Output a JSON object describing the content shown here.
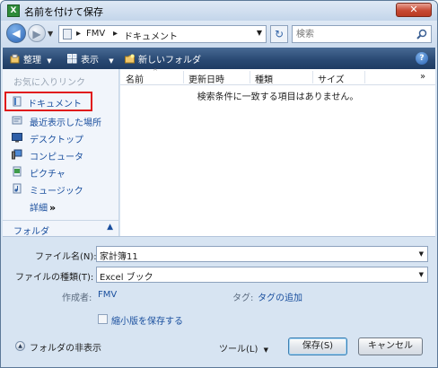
{
  "window": {
    "title": "名前を付けて保存",
    "app_icon_text": "X"
  },
  "nav": {
    "breadcrumb": [
      "FMV",
      "ドキュメント"
    ],
    "search_placeholder": "検索"
  },
  "toolbar": {
    "organize": "整理",
    "views": "表示",
    "new_folder": "新しいフォルダ",
    "help": "?"
  },
  "sidebar": {
    "title": "お気に入りリンク",
    "items": [
      {
        "label": "ドキュメント",
        "icon": "documents-icon",
        "selected": true
      },
      {
        "label": "最近表示した場所",
        "icon": "recent-places-icon"
      },
      {
        "label": "デスクトップ",
        "icon": "desktop-icon"
      },
      {
        "label": "コンピュータ",
        "icon": "computer-icon"
      },
      {
        "label": "ピクチャ",
        "icon": "pictures-icon"
      },
      {
        "label": "ミュージック",
        "icon": "music-icon"
      }
    ],
    "details": "詳細",
    "details_chevron": "»",
    "folders": "フォルダ"
  },
  "filelist": {
    "columns": [
      "名前",
      "更新日時",
      "種類",
      "サイズ"
    ],
    "more": "»",
    "empty_message": "検索条件に一致する項目はありません。"
  },
  "form": {
    "filename_label": "ファイル名(N):",
    "filename_value": "家計簿11",
    "filetype_label": "ファイルの種類(T):",
    "filetype_value": "Excel ブック",
    "author_label": "作成者:",
    "author_value": "FMV",
    "tags_label": "タグ:",
    "tags_value": "タグの追加",
    "thumbnail_label": "縮小版を保存する",
    "thumbnail_checked": false
  },
  "footer": {
    "hide_folders": "フォルダの非表示",
    "tools": "ツール(L)",
    "save": "保存(S)",
    "cancel": "キャンセル"
  }
}
